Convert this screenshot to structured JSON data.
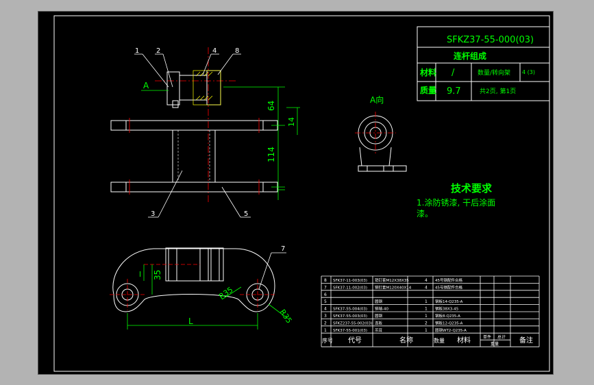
{
  "colors": {
    "background": "#b3b3b3",
    "paper": "#000000",
    "frame": "#ffffff",
    "geometry": "#ffffff",
    "dimension": "#00ff00",
    "title_text": "#00ff00",
    "centerline": "#ff0000",
    "hatch": "#ffff00",
    "leader": "#ffffff"
  },
  "title_block": {
    "drawing_no": "SFKZ37-55-000(03)",
    "name": "连杆组成",
    "material_label": "材料",
    "material_value": "/",
    "quantity_label": "数量/转向架",
    "quantity_value": "4 (3)",
    "mass_label": "质量",
    "mass_value": "9.7",
    "sheet_info": "共2页, 第1页"
  },
  "view_labels": {
    "section_a": "A",
    "view_a": "A向"
  },
  "dimensions": {
    "d64": "64",
    "d14": "14",
    "d114": "114",
    "d35": "35",
    "dR35a": "R35",
    "dR35b": "R35",
    "dL": "L",
    "dI": "l"
  },
  "balloons": [
    "1",
    "2",
    "4",
    "8",
    "3",
    "5",
    "7"
  ],
  "tech": {
    "title": "技术要求",
    "line1": "1.涂防锈漆, 干后涂面",
    "line2": "漆。"
  },
  "bom": {
    "headers": {
      "seq": "序号",
      "code": "代号",
      "name": "名称",
      "qty": "数量",
      "material": "材料",
      "unit_weight": "单件",
      "total_weight": "总计",
      "weight": "重量",
      "remark": "备注"
    },
    "rows": [
      {
        "seq": "8",
        "code": "SFK37-11-003(03)",
        "name": "销钉套M12X38X35",
        "qty": "4",
        "material": "45号钢配件合格",
        "remark": ""
      },
      {
        "seq": "7",
        "code": "SFK37-11-002(03)",
        "name": "销钉套M120X40X14",
        "qty": "4",
        "material": "45号钢配件合格",
        "remark": ""
      },
      {
        "seq": "6",
        "code": "",
        "name": "",
        "qty": "",
        "material": "",
        "remark": ""
      },
      {
        "seq": "5",
        "code": "",
        "name": "圆钢",
        "qty": "1",
        "material": "钢板14-Q235-A",
        "remark": ""
      },
      {
        "seq": "4",
        "code": "SFK37-55-004(03)",
        "name": "销轴-40",
        "qty": "1",
        "material": "钢板38X3-45",
        "remark": ""
      },
      {
        "seq": "3",
        "code": "SFK37-55-003(03)",
        "name": "圆钢",
        "qty": "1",
        "material": "钢板8-Q235-A",
        "remark": ""
      },
      {
        "seq": "2",
        "code": "SFKZ237-55-002(03)",
        "name": "连板",
        "qty": "2",
        "material": "钢板12-Q235-A",
        "remark": ""
      },
      {
        "seq": "1",
        "code": "SFK37-55-001(03)",
        "name": "吊耳",
        "qty": "1",
        "material": "圆钢WT2-Q235-A",
        "remark": ""
      }
    ]
  }
}
